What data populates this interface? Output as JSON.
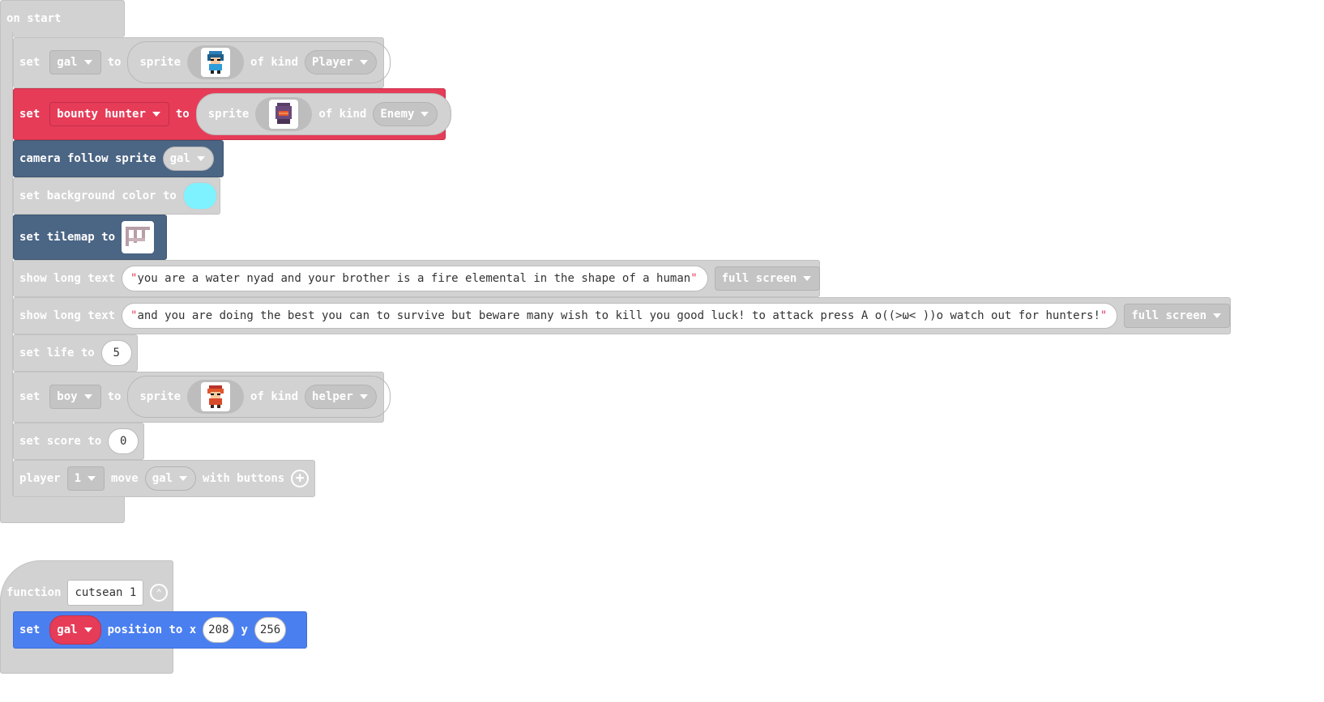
{
  "on_start": {
    "label": "on start",
    "blocks": {
      "set_gal": {
        "set": "set",
        "var": "gal",
        "to": "to",
        "sprite": "sprite",
        "of_kind": "of kind",
        "kind": "Player"
      },
      "set_bounty": {
        "set": "set",
        "var": "bounty hunter",
        "to": "to",
        "sprite": "sprite",
        "of_kind": "of kind",
        "kind": "Enemy"
      },
      "camera": {
        "label": "camera follow sprite",
        "var": "gal"
      },
      "bg_color": {
        "label": "set background color to",
        "color": "#7ff2ff"
      },
      "tilemap": {
        "label": "set tilemap to"
      },
      "long_text_1": {
        "label": "show long text",
        "text": "you are a water nyad and your brother is a fire elemental in the shape of a human",
        "mode": "full screen"
      },
      "long_text_2": {
        "label": "show long text",
        "text": "and you are doing the best you can to survive but beware many wish to kill you good luck! to attack press A o((>ω< ))o watch out for hunters!",
        "mode": "full screen"
      },
      "life": {
        "label": "set life to",
        "value": "5"
      },
      "set_boy": {
        "set": "set",
        "var": "boy",
        "to": "to",
        "sprite": "sprite",
        "of_kind": "of kind",
        "kind": "helper"
      },
      "score": {
        "label": "set score to",
        "value": "0"
      },
      "player_move": {
        "player": "player",
        "num": "1",
        "move": "move",
        "var": "gal",
        "with": "with buttons"
      }
    }
  },
  "function_block": {
    "label": "function",
    "name": "cutsean 1",
    "set_position": {
      "set": "set",
      "var": "gal",
      "position": "position to x",
      "x": "208",
      "y_label": "y",
      "y": "256"
    }
  },
  "colors": {
    "gray": "#d2d2d2",
    "red": "#e63c58",
    "navy": "#4b6584",
    "blue": "#4a7ff0"
  }
}
